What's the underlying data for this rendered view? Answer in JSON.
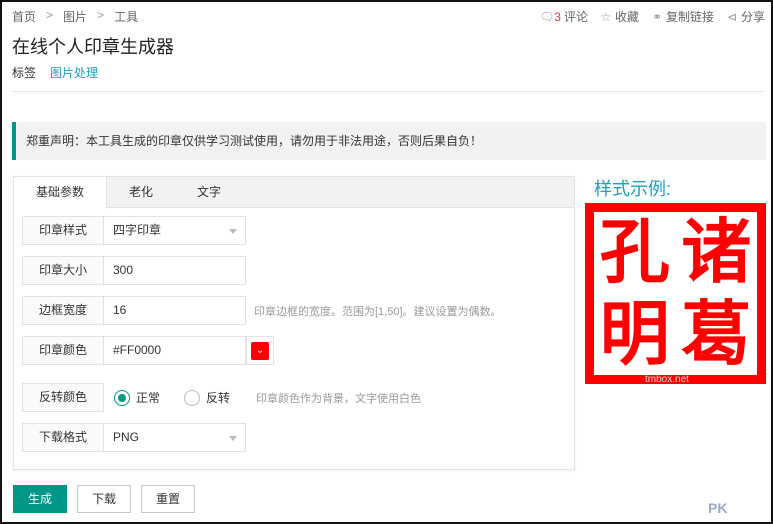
{
  "breadcrumb": {
    "items": [
      "首页",
      "图片",
      "工具"
    ],
    "separator": ">"
  },
  "actions": {
    "comments_count": "3",
    "comments_label": "评论",
    "favorite_label": "收藏",
    "copy_link_label": "复制链接",
    "share_label": "分享"
  },
  "page": {
    "title": "在线个人印章生成器"
  },
  "tags": {
    "label": "标签",
    "link": "图片处理"
  },
  "notice": {
    "text": "郑重声明：本工具生成的印章仅供学习测试使用，请勿用于非法用途，否则后果自负！"
  },
  "tabs": [
    {
      "label": "基础参数",
      "active": true
    },
    {
      "label": "老化",
      "active": false
    },
    {
      "label": "文字",
      "active": false
    }
  ],
  "form": {
    "style": {
      "label": "印章样式",
      "value": "四字印章"
    },
    "size": {
      "label": "印章大小",
      "value": "300"
    },
    "border": {
      "label": "边框宽度",
      "value": "16",
      "hint": "印章边框的宽度。范围为[1,50]。建议设置为偶数。"
    },
    "color": {
      "label": "印章颜色",
      "value": "#FF0000",
      "swatch": "#ff0000"
    },
    "invert": {
      "label": "反转颜色",
      "option_normal": "正常",
      "option_invert": "反转",
      "selected": "正常",
      "hint": "印章颜色作为背景，文字使用白色"
    },
    "format": {
      "label": "下载格式",
      "value": "PNG"
    }
  },
  "buttons": {
    "generate": "生成",
    "download": "下载",
    "reset": "重置"
  },
  "sample": {
    "title": "样式示例:",
    "chars": [
      "孔",
      "诸",
      "明",
      "葛"
    ],
    "color": "#ff0000"
  },
  "watermarks": {
    "url": "tmbox.net",
    "logo": "PK"
  },
  "colors": {
    "accent": "#009688",
    "link": "#1e9fbf"
  }
}
